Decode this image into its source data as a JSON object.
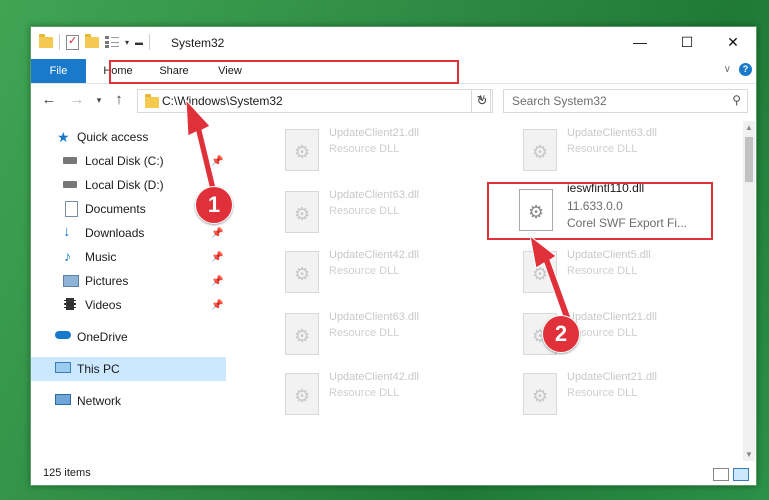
{
  "window": {
    "title": "System32",
    "controls": {
      "minimize": "—",
      "maximize": "☐",
      "close": "✕"
    }
  },
  "ribbon": {
    "tabs": [
      "File",
      "Home",
      "Share",
      "View"
    ]
  },
  "nav": {
    "address": "C:\\Windows\\System32",
    "search_placeholder": "Search System32"
  },
  "sidebar": {
    "items": [
      {
        "label": "Quick access",
        "icon": "star-icon"
      },
      {
        "label": "Local Disk (C:)",
        "icon": "drive-icon"
      },
      {
        "label": "Local Disk (D:)",
        "icon": "drive-icon"
      },
      {
        "label": "Documents",
        "icon": "documents-icon"
      },
      {
        "label": "Downloads",
        "icon": "download-icon"
      },
      {
        "label": "Music",
        "icon": "music-icon"
      },
      {
        "label": "Pictures",
        "icon": "pictures-icon"
      },
      {
        "label": "Videos",
        "icon": "videos-icon"
      },
      {
        "label": "OneDrive",
        "icon": "cloud-icon"
      },
      {
        "label": "This PC",
        "icon": "computer-icon"
      },
      {
        "label": "Network",
        "icon": "network-icon"
      }
    ]
  },
  "files": [
    {
      "name": "UpdateClient21.dll",
      "sub": "Resource DLL"
    },
    {
      "name": "UpdateClient63.dll",
      "sub": "Resource DLL"
    },
    {
      "name": "UpdateClient63.dll",
      "sub": "Resource DLL"
    },
    {
      "name": "ieswfintl110.dll",
      "sub": "11.633.0.0",
      "sub2": "Corel SWF Export Fi..."
    },
    {
      "name": "UpdateClient42.dll",
      "sub": "Resource DLL"
    },
    {
      "name": "UpdateClient5.dll",
      "sub": "Resource DLL"
    },
    {
      "name": "UpdateClient63.dll",
      "sub": "Resource DLL"
    },
    {
      "name": "UpdateClient21.dll",
      "sub": "Resource DLL"
    },
    {
      "name": "UpdateClient42.dll",
      "sub": "Resource DLL"
    },
    {
      "name": "UpdateClient21.dll",
      "sub": "Resource DLL"
    }
  ],
  "status": {
    "count": "125 items"
  },
  "markers": {
    "one": "1",
    "two": "2"
  },
  "colors": {
    "accent": "#1979ca",
    "highlight": "#e0303a",
    "selected": "#cce8ff"
  }
}
